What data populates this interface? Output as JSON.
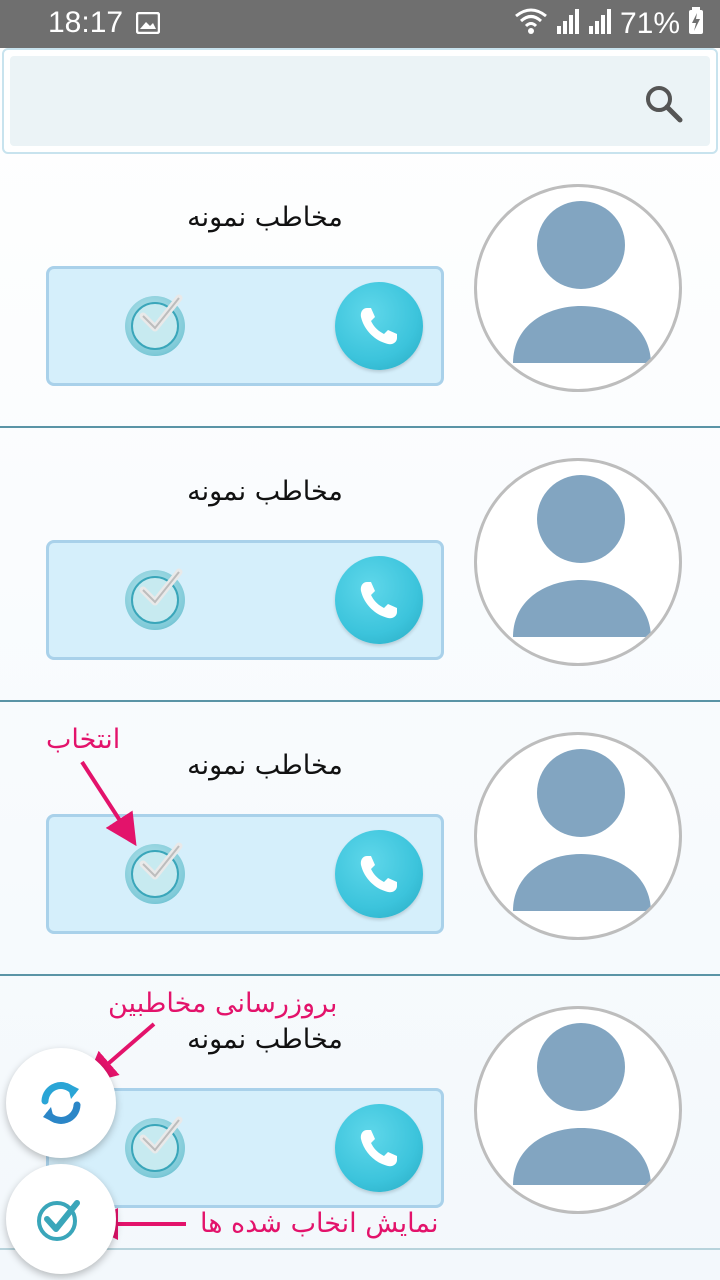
{
  "status_bar": {
    "time": "18:17",
    "battery": "71%",
    "icons": [
      "gallery-icon",
      "wifi-icon",
      "signal-icon",
      "battery-charging-icon"
    ]
  },
  "search": {
    "placeholder": "",
    "icon": "search-icon"
  },
  "contacts": [
    {
      "name": "مخاطب نمونه"
    },
    {
      "name": "مخاطب نمونه"
    },
    {
      "name": "مخاطب نمونه"
    },
    {
      "name": "مخاطب نمونه"
    }
  ],
  "annotations": {
    "select": "انتخاب",
    "refresh_contacts": "بروزرسانی مخاطبین",
    "show_selected": "نمایش انخاب شده ها"
  },
  "colors": {
    "accent": "#3cc4dc",
    "annotation": "#e3136b",
    "avatar": "#82a5c1",
    "panel": "#d5effb"
  }
}
